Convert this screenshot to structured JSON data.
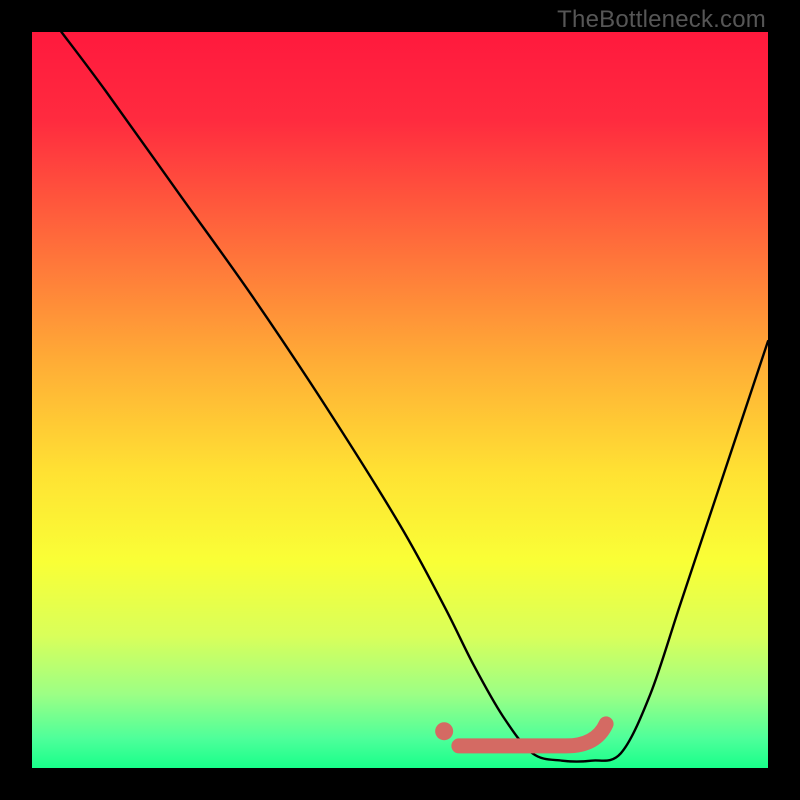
{
  "watermark": "TheBottleneck.com",
  "chart_data": {
    "type": "line",
    "title": "",
    "xlabel": "",
    "ylabel": "",
    "xlim": [
      0,
      100
    ],
    "ylim": [
      0,
      100
    ],
    "grid": false,
    "series": [
      {
        "name": "bottleneck-curve",
        "x": [
          4,
          10,
          20,
          30,
          40,
          50,
          56,
          60,
          64,
          68,
          72,
          76,
          80,
          84,
          88,
          92,
          96,
          100
        ],
        "y": [
          100,
          92,
          78,
          64,
          49,
          33,
          22,
          14,
          7,
          2,
          1,
          1,
          2,
          10,
          22,
          34,
          46,
          58
        ]
      }
    ],
    "markers": [
      {
        "name": "optimal-dot",
        "x": 56,
        "y": 5
      }
    ],
    "highlight_band": {
      "name": "optimal-range",
      "x_start": 58,
      "x_end": 78,
      "y": 3
    },
    "gradient_stops": [
      {
        "offset": 0.0,
        "color": "#ff193d"
      },
      {
        "offset": 0.12,
        "color": "#ff2b3f"
      },
      {
        "offset": 0.28,
        "color": "#ff6a3b"
      },
      {
        "offset": 0.45,
        "color": "#ffad36"
      },
      {
        "offset": 0.6,
        "color": "#ffe233"
      },
      {
        "offset": 0.72,
        "color": "#f9ff36"
      },
      {
        "offset": 0.82,
        "color": "#d9ff5a"
      },
      {
        "offset": 0.9,
        "color": "#9cff85"
      },
      {
        "offset": 0.96,
        "color": "#4eff9a"
      },
      {
        "offset": 1.0,
        "color": "#18ff8a"
      }
    ]
  }
}
